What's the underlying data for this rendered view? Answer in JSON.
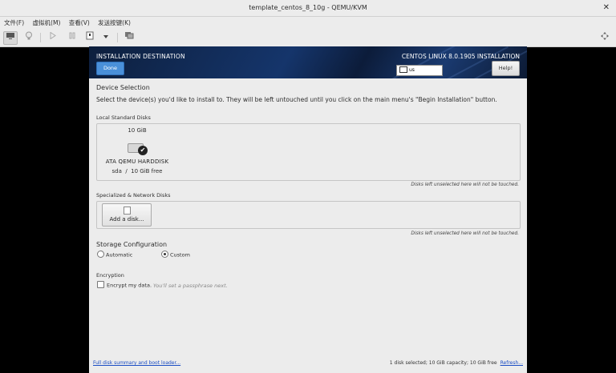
{
  "window": {
    "title": "template_centos_8_10g - QEMU/KVM",
    "close_glyph": "✕"
  },
  "menu": [
    "文件(F)",
    "虚拟机(M)",
    "查看(V)",
    "发送按键(K)"
  ],
  "toolbar": {
    "icons": [
      "monitor-icon",
      "lightbulb-icon",
      "play-icon",
      "pause-icon",
      "power-icon",
      "dropdown-icon",
      "screenshot-icon",
      "fullscreen-icon"
    ]
  },
  "installer": {
    "header_title": "INSTALLATION DESTINATION",
    "done_label": "Done",
    "product": "CENTOS LINUX 8.0.1905 INSTALLATION",
    "keyboard": "us",
    "help_label": "Help!",
    "device_selection": "Device Selection",
    "description": "Select the device(s) you'd like to install to.  They will be left untouched until you click on the main menu's \"Begin Installation\" button.",
    "local_disks_heading": "Local Standard Disks",
    "disk": {
      "capacity": "10 GiB",
      "name": "ATA QEMU HARDDISK",
      "device": "sda",
      "separator": "/",
      "free": "10 GiB free",
      "selected": true
    },
    "untouched_note": "Disks left unselected here will not be touched.",
    "network_disks_heading": "Specialized & Network Disks",
    "add_disk_label": "Add a disk...",
    "storage_heading": "Storage Configuration",
    "storage_options": [
      "Automatic",
      "Custom"
    ],
    "storage_selected": "Custom",
    "encryption_heading": "Encryption",
    "encrypt_label": "Encrypt my data.",
    "encrypt_hint": "You'll set a passphrase next.",
    "encrypt_checked": false,
    "summary_link": "Full disk summary and boot loader...",
    "status": "1 disk selected; 10 GiB capacity; 10 GiB free",
    "refresh_label": "Refresh..."
  },
  "colors": {
    "accent": "#4a90d9",
    "header_bg": "#15356b",
    "link": "#1a4dc4"
  }
}
